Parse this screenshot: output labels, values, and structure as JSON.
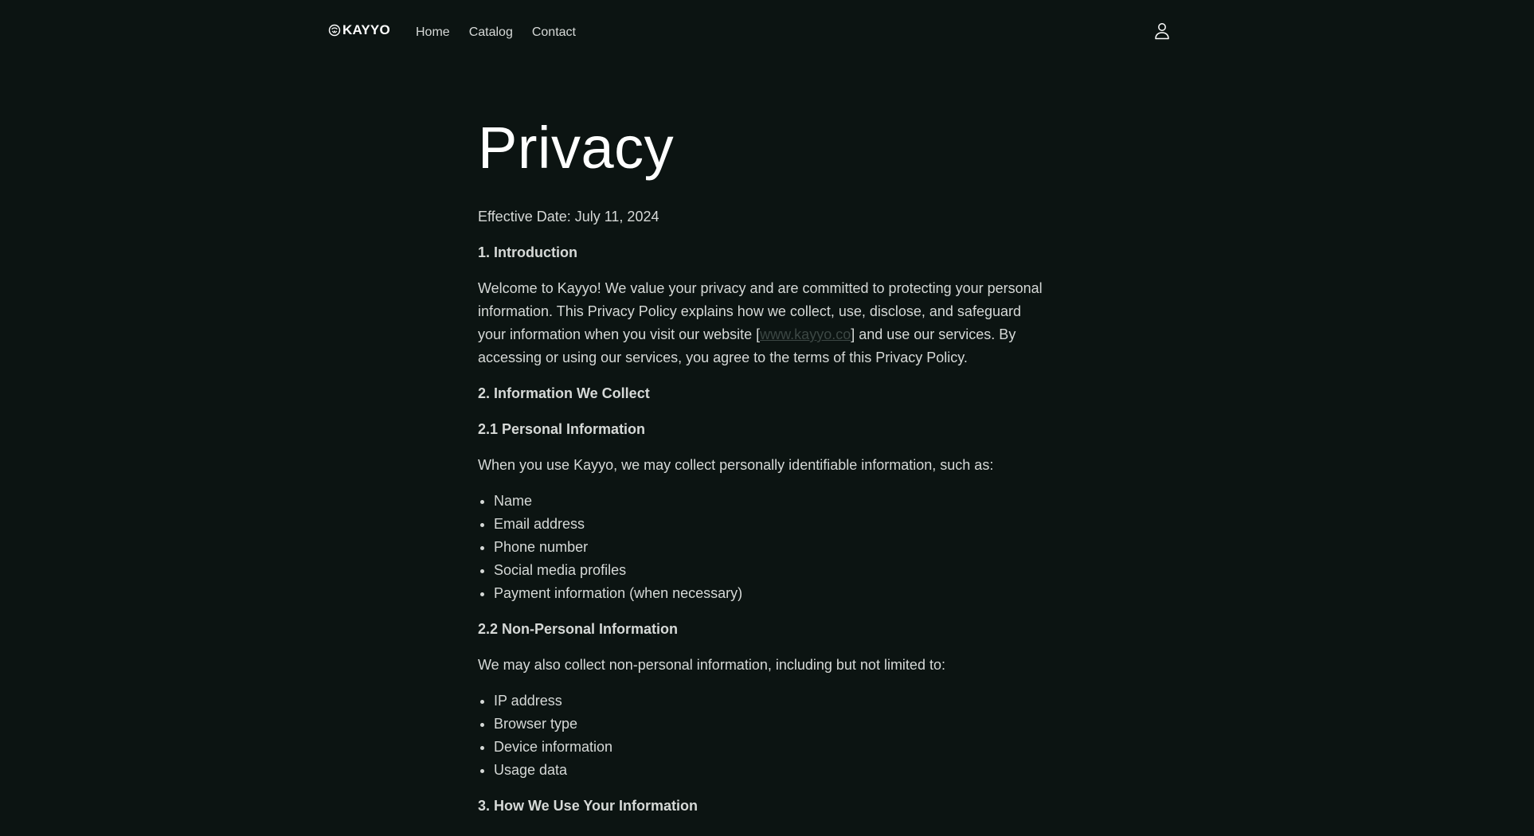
{
  "header": {
    "logo_text": "KAYYO",
    "nav": [
      "Home",
      "Catalog",
      "Contact"
    ]
  },
  "page": {
    "title": "Privacy",
    "effective_date": "Effective Date: July 11, 2024",
    "s1_heading": "1. Introduction",
    "s1_p_a": "Welcome to Kayyo! We value your privacy and are committed to protecting your personal information. This Privacy Policy explains how we collect, use, disclose, and safeguard your information when you visit our website [",
    "s1_link": "www.kayyo.co",
    "s1_p_b": "] and use our services. By accessing or using our services, you agree to the terms of this Privacy Policy.",
    "s2_heading": "2. Information We Collect",
    "s21_heading": "2.1 Personal Information",
    "s21_intro": "When you use Kayyo, we may collect personally identifiable information, such as:",
    "s21_items": [
      "Name",
      "Email address",
      "Phone number",
      "Social media profiles",
      "Payment information (when necessary)"
    ],
    "s22_heading": "2.2 Non-Personal Information",
    "s22_intro": "We may also collect non-personal information, including but not limited to:",
    "s22_items": [
      "IP address",
      "Browser type",
      "Device information",
      "Usage data"
    ],
    "s3_heading": "3. How We Use Your Information"
  },
  "colors": {
    "background": "#0c1412",
    "text": "#d6d9d7",
    "title": "#ffffff",
    "link": "#3c4744"
  },
  "icons": {
    "logo": "kayyo-logo-icon",
    "account": "user-icon"
  }
}
